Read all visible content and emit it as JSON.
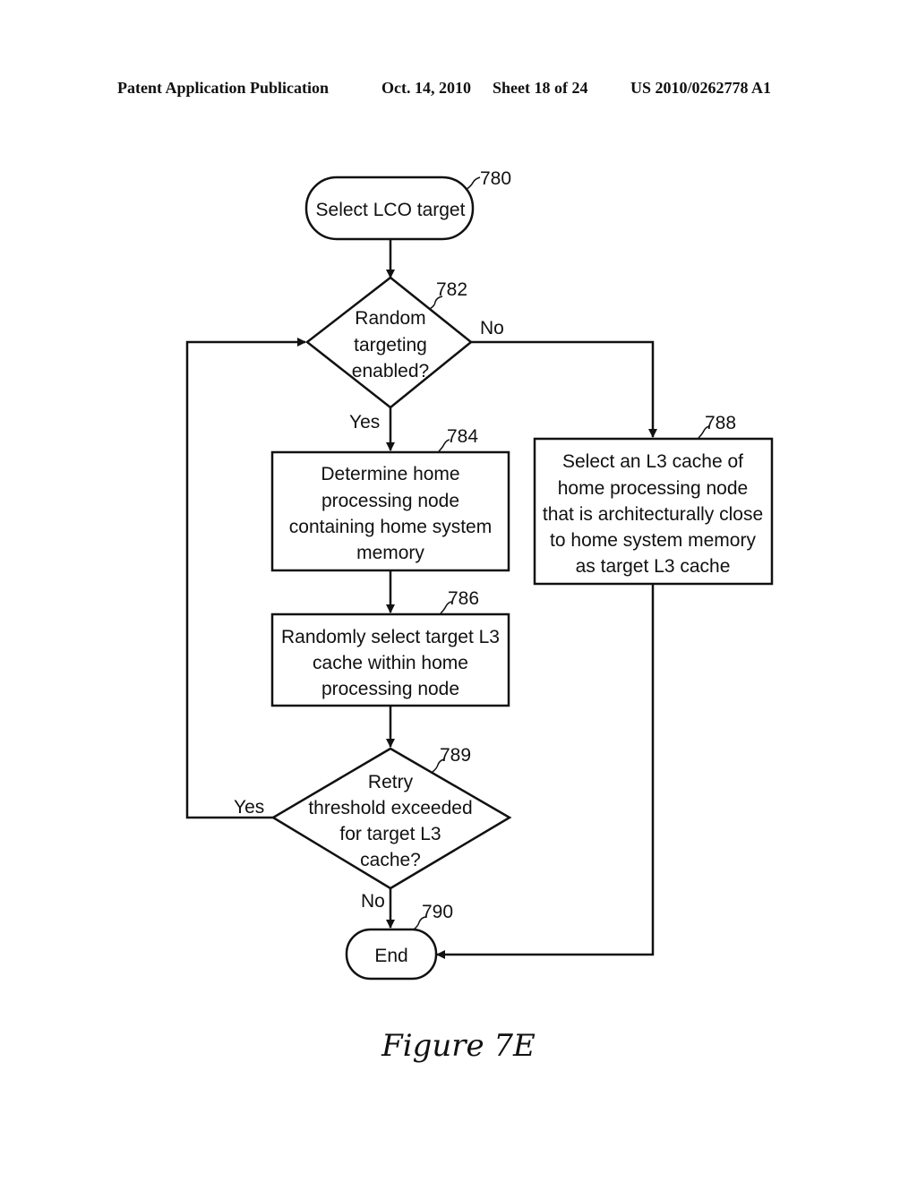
{
  "header": {
    "title": "Patent Application Publication",
    "date": "Oct. 14, 2010",
    "sheet": "Sheet 18 of 24",
    "publication_number": "US 2010/0262778 A1"
  },
  "nodes": {
    "n780": {
      "ref": "780",
      "type": "terminal",
      "lines": [
        "Select LCO target"
      ]
    },
    "n782": {
      "ref": "782",
      "type": "decision",
      "lines": [
        "Random",
        "targeting",
        "enabled?"
      ]
    },
    "n784": {
      "ref": "784",
      "type": "process",
      "lines": [
        "Determine home",
        "processing node",
        "containing home system",
        "memory"
      ]
    },
    "n786": {
      "ref": "786",
      "type": "process",
      "lines": [
        "Randomly select target L3",
        "cache within home",
        "processing node"
      ]
    },
    "n788": {
      "ref": "788",
      "type": "process",
      "lines": [
        "Select an L3 cache of",
        "home processing node",
        "that is architecturally close",
        "to home system memory",
        "as target L3 cache"
      ]
    },
    "n789": {
      "ref": "789",
      "type": "decision",
      "lines": [
        "Retry",
        "threshold exceeded",
        "for target L3",
        "cache?"
      ]
    },
    "n790": {
      "ref": "790",
      "type": "terminal",
      "lines": [
        "End"
      ]
    }
  },
  "edges": {
    "e782_no": "No",
    "e782_yes": "Yes",
    "e789_yes": "Yes",
    "e789_no": "No"
  },
  "caption": "Figure 7E"
}
